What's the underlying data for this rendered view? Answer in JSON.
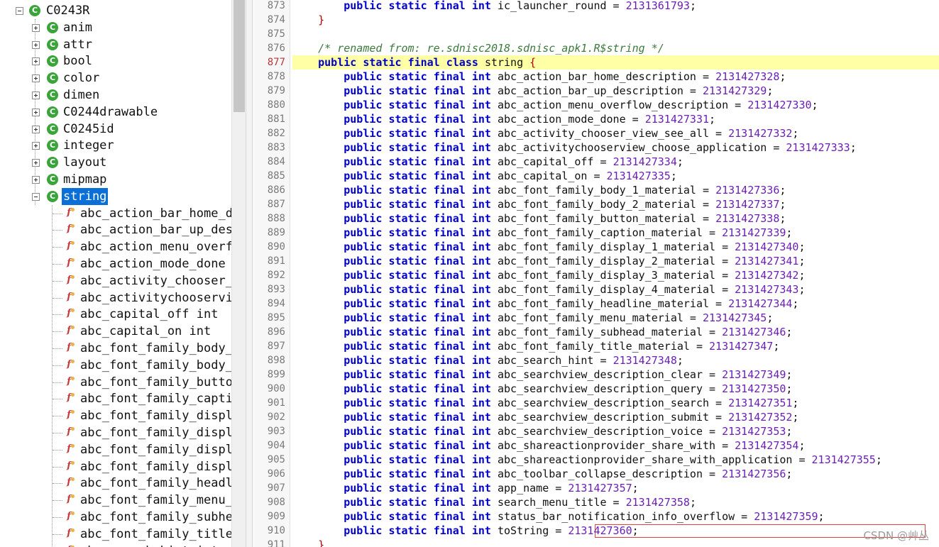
{
  "tree": {
    "root": {
      "label": "C0243R",
      "icon": "class-icon"
    },
    "children": [
      {
        "label": "anim",
        "expanded": false
      },
      {
        "label": "attr",
        "expanded": false
      },
      {
        "label": "bool",
        "expanded": false
      },
      {
        "label": "color",
        "expanded": false
      },
      {
        "label": "dimen",
        "expanded": false
      },
      {
        "label": "C0244drawable",
        "expanded": false
      },
      {
        "label": "C0245id",
        "expanded": false
      },
      {
        "label": "integer",
        "expanded": false
      },
      {
        "label": "layout",
        "expanded": false
      },
      {
        "label": "mipmap",
        "expanded": false
      },
      {
        "label": "string",
        "expanded": true,
        "selected": true
      }
    ],
    "string_fields": [
      "abc_action_bar_home_de",
      "abc_action_bar_up_desc",
      "abc_action_menu_overfl",
      "abc_action_mode_done i",
      "abc_activity_chooser_v",
      "abc_activitychooservie",
      "abc_capital_off int",
      "abc_capital_on int",
      "abc_font_family_body_",
      "abc_font_family_body_",
      "abc_font_family_butto",
      "abc_font_family_captio",
      "abc_font_family_displa",
      "abc_font_family_displa",
      "abc_font_family_displa",
      "abc_font_family_displa",
      "abc_font_family_headli",
      "abc_font_family_menu_m",
      "abc_font_family_subhea",
      "abc_font_family_title_",
      "abc_search_hint int"
    ]
  },
  "editor": {
    "current_line": "877",
    "lines": [
      {
        "n": "873",
        "kind": "field",
        "name": "ic_launcher_round",
        "value": "2131361793"
      },
      {
        "n": "874",
        "kind": "close",
        "text": "}"
      },
      {
        "n": "875",
        "kind": "blank"
      },
      {
        "n": "876",
        "kind": "comment",
        "text": "/* renamed from: re.sdnisc2018.sdnisc_apk1.R$string */"
      },
      {
        "n": "877",
        "kind": "class",
        "name": "string"
      },
      {
        "n": "878",
        "kind": "field",
        "name": "abc_action_bar_home_description",
        "value": "2131427328"
      },
      {
        "n": "879",
        "kind": "field",
        "name": "abc_action_bar_up_description",
        "value": "2131427329"
      },
      {
        "n": "880",
        "kind": "field",
        "name": "abc_action_menu_overflow_description",
        "value": "2131427330"
      },
      {
        "n": "881",
        "kind": "field",
        "name": "abc_action_mode_done",
        "value": "2131427331"
      },
      {
        "n": "882",
        "kind": "field",
        "name": "abc_activity_chooser_view_see_all",
        "value": "2131427332"
      },
      {
        "n": "883",
        "kind": "field",
        "name": "abc_activitychooserview_choose_application",
        "value": "2131427333"
      },
      {
        "n": "884",
        "kind": "field",
        "name": "abc_capital_off",
        "value": "2131427334"
      },
      {
        "n": "885",
        "kind": "field",
        "name": "abc_capital_on",
        "value": "2131427335"
      },
      {
        "n": "886",
        "kind": "field",
        "name": "abc_font_family_body_1_material",
        "value": "2131427336"
      },
      {
        "n": "887",
        "kind": "field",
        "name": "abc_font_family_body_2_material",
        "value": "2131427337"
      },
      {
        "n": "888",
        "kind": "field",
        "name": "abc_font_family_button_material",
        "value": "2131427338"
      },
      {
        "n": "889",
        "kind": "field",
        "name": "abc_font_family_caption_material",
        "value": "2131427339"
      },
      {
        "n": "890",
        "kind": "field",
        "name": "abc_font_family_display_1_material",
        "value": "2131427340"
      },
      {
        "n": "891",
        "kind": "field",
        "name": "abc_font_family_display_2_material",
        "value": "2131427341"
      },
      {
        "n": "892",
        "kind": "field",
        "name": "abc_font_family_display_3_material",
        "value": "2131427342"
      },
      {
        "n": "893",
        "kind": "field",
        "name": "abc_font_family_display_4_material",
        "value": "2131427343"
      },
      {
        "n": "894",
        "kind": "field",
        "name": "abc_font_family_headline_material",
        "value": "2131427344"
      },
      {
        "n": "895",
        "kind": "field",
        "name": "abc_font_family_menu_material",
        "value": "2131427345"
      },
      {
        "n": "896",
        "kind": "field",
        "name": "abc_font_family_subhead_material",
        "value": "2131427346"
      },
      {
        "n": "897",
        "kind": "field",
        "name": "abc_font_family_title_material",
        "value": "2131427347"
      },
      {
        "n": "898",
        "kind": "field",
        "name": "abc_search_hint",
        "value": "2131427348"
      },
      {
        "n": "899",
        "kind": "field",
        "name": "abc_searchview_description_clear",
        "value": "2131427349"
      },
      {
        "n": "900",
        "kind": "field",
        "name": "abc_searchview_description_query",
        "value": "2131427350"
      },
      {
        "n": "901",
        "kind": "field",
        "name": "abc_searchview_description_search",
        "value": "2131427351"
      },
      {
        "n": "902",
        "kind": "field",
        "name": "abc_searchview_description_submit",
        "value": "2131427352"
      },
      {
        "n": "903",
        "kind": "field",
        "name": "abc_searchview_description_voice",
        "value": "2131427353"
      },
      {
        "n": "904",
        "kind": "field",
        "name": "abc_shareactionprovider_share_with",
        "value": "2131427354"
      },
      {
        "n": "905",
        "kind": "field",
        "name": "abc_shareactionprovider_share_with_application",
        "value": "2131427355"
      },
      {
        "n": "906",
        "kind": "field",
        "name": "abc_toolbar_collapse_description",
        "value": "2131427356"
      },
      {
        "n": "907",
        "kind": "field",
        "name": "app_name",
        "value": "2131427357"
      },
      {
        "n": "908",
        "kind": "field",
        "name": "search_menu_title",
        "value": "2131427358"
      },
      {
        "n": "909",
        "kind": "field",
        "name": "status_bar_notification_info_overflow",
        "value": "2131427359"
      },
      {
        "n": "910",
        "kind": "field",
        "name": "toString",
        "value": "2131427360",
        "boxed": true
      },
      {
        "n": "911",
        "kind": "close",
        "text": "}"
      }
    ]
  },
  "watermark": "CSDN @艸丛",
  "colors": {
    "selection": "#0a6fd6",
    "keyword": "#0000c8",
    "number": "#6b1fb4",
    "comment": "#3c7a3c",
    "highlight": "#ffffa6",
    "box": "#e04040"
  }
}
